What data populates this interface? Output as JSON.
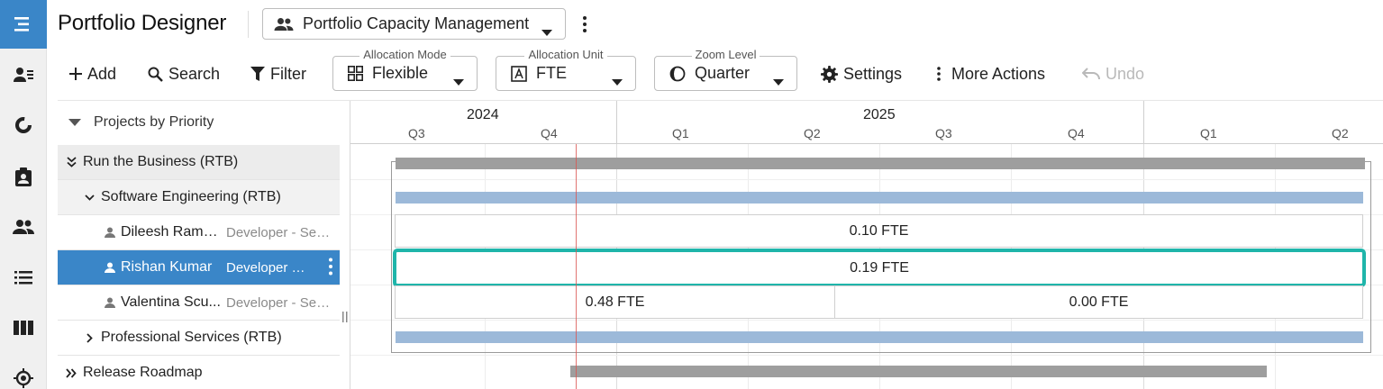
{
  "header": {
    "app_title": "Portfolio Designer",
    "view_selector": "Portfolio Capacity Management"
  },
  "toolbar": {
    "add": "Add",
    "search": "Search",
    "filter": "Filter",
    "allocation_mode": {
      "legend": "Allocation Mode",
      "value": "Flexible"
    },
    "allocation_unit": {
      "legend": "Allocation Unit",
      "value": "FTE"
    },
    "zoom_level": {
      "legend": "Zoom Level",
      "value": "Quarter"
    },
    "settings": "Settings",
    "more_actions": "More Actions",
    "undo": "Undo"
  },
  "tree": {
    "header": "Projects by Priority",
    "rows": [
      {
        "label": "Run the Business (RTB)"
      },
      {
        "label": "Software Engineering (RTB)"
      },
      {
        "name": "Dileesh Rama...",
        "role": "Developer - Sen..."
      },
      {
        "name": "Rishan Kumar",
        "role": "Developer - ..."
      },
      {
        "name": "Valentina Scu...",
        "role": "Developer - Sen..."
      },
      {
        "label": "Professional Services (RTB)"
      },
      {
        "label": "Release Roadmap"
      }
    ]
  },
  "timeline": {
    "years": [
      "2024",
      "2025"
    ],
    "quarters": [
      "Q3",
      "Q4",
      "Q1",
      "Q2",
      "Q3",
      "Q4",
      "Q1",
      "Q2"
    ],
    "allocations": {
      "dileesh": "0.10 FTE",
      "rishan": "0.19 FTE",
      "valentina_1": "0.48 FTE",
      "valentina_2": "0.00 FTE"
    }
  },
  "colors": {
    "accent": "#3a86c8",
    "selection_outline": "#1fb5aa",
    "today_line": "#d9534f"
  }
}
